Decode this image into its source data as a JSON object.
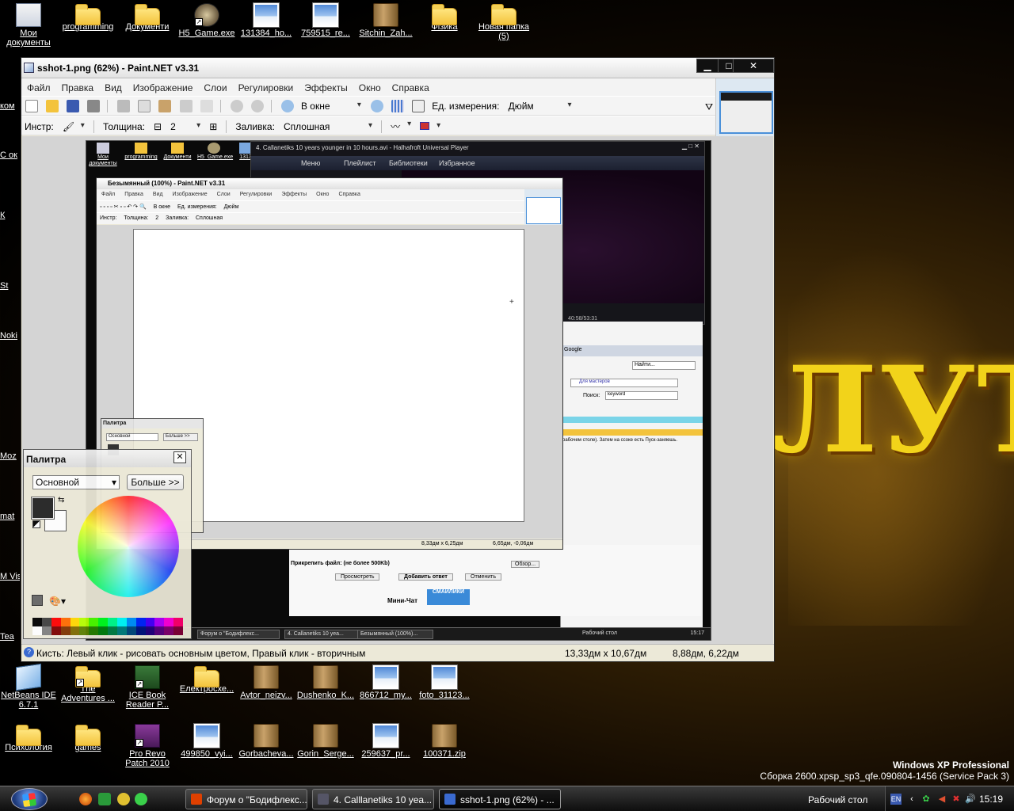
{
  "desktop": {
    "top_icons": [
      {
        "label": "Мои документы",
        "kind": "doc"
      },
      {
        "label": "programming",
        "kind": "folder"
      },
      {
        "label": "Документи",
        "kind": "folder"
      },
      {
        "label": "H5_Game.exe",
        "kind": "exe"
      },
      {
        "label": "131384_ho...",
        "kind": "image"
      },
      {
        "label": "759515_re...",
        "kind": "image"
      },
      {
        "label": "Sitchin_Zah...",
        "kind": "book"
      },
      {
        "label": "Фізика",
        "kind": "folder"
      },
      {
        "label": "Новая папка (5)",
        "kind": "folder"
      }
    ],
    "bottom_row1": [
      {
        "label": "NetBeans IDE 6.7.1",
        "kind": "cube"
      },
      {
        "label": "The Adventures ...",
        "kind": "folder"
      },
      {
        "label": "ICE Book Reader P...",
        "kind": "green"
      },
      {
        "label": "Електросхе...",
        "kind": "folder"
      },
      {
        "label": "Avtor_neizv...",
        "kind": "book"
      },
      {
        "label": "Dushenko_K...",
        "kind": "book"
      },
      {
        "label": "866712_my...",
        "kind": "image"
      },
      {
        "label": "foto_31123...",
        "kind": "image"
      }
    ],
    "bottom_row2": [
      {
        "label": "Психология",
        "kind": "folder"
      },
      {
        "label": "games",
        "kind": "folder"
      },
      {
        "label": "Pro Revo Patch 2010",
        "kind": "revo"
      },
      {
        "label": "499850_vyi...",
        "kind": "image"
      },
      {
        "label": "Gorbacheva...",
        "kind": "book"
      },
      {
        "label": "Gorin_Serge...",
        "kind": "book"
      },
      {
        "label": "259637_pr...",
        "kind": "image"
      },
      {
        "label": "100371.zip",
        "kind": "book"
      }
    ],
    "left_strip": [
      "ком",
      "С ок",
      "К",
      "St",
      "Noki",
      "Moz",
      "mat",
      "M Vis",
      "Tea"
    ],
    "wallpaper_text": "ЛУТ",
    "os_label": "Windows XP Professional",
    "build_label": "Сборка 2600.xpsp_sp3_qfe.090804-1456 (Service Pack 3)"
  },
  "window": {
    "title": "sshot-1.png (62%) - Paint.NET v3.31",
    "buttons": {
      "minimize": "▁",
      "maximize": "□",
      "close": "✕"
    },
    "menu": [
      "Файл",
      "Правка",
      "Вид",
      "Изображение",
      "Слои",
      "Регулировки",
      "Эффекты",
      "Окно",
      "Справка"
    ],
    "toolbar1": {
      "zoom_value": "В окне",
      "units_label": "Ед. измерения:",
      "units_value": "Дюйм"
    },
    "toolbar2": {
      "tool_label": "Инстр:",
      "thickness_label": "Толщина:",
      "thickness_value": "2",
      "fill_label": "Заливка:",
      "fill_value": "Сплошная"
    },
    "status": {
      "hint": "Кисть: Левый клик - рисовать основным цветом, Правый клик - вторичным",
      "size": "13,33дм x 10,67дм",
      "position": "8,88дм, 6,22дм"
    }
  },
  "shot": {
    "player_title": "4. Callanetiks 10 years younger in 10 hours.avi - Halhafroft Universal Player",
    "player_menu": [
      "Меню",
      "Плейлист",
      "Библиотеки",
      "Избранное"
    ],
    "player_time": "40:58/53:31",
    "inner_title": "Безымянный (100%) - Paint.NET v3.31",
    "inner_menu": [
      "Файл",
      "Правка",
      "Вид",
      "Изображение",
      "Слои",
      "Регулировки",
      "Эффекты",
      "Окно",
      "Справка"
    ],
    "inner_status_size": "8,33дм x 6,25дм",
    "inner_status_pos": "6,65дм, -0,06дм",
    "small_palette_title": "Палитра",
    "small_palette_select": "Основной",
    "small_palette_more": "Больше >>",
    "browser_search": "Google",
    "browser_find": "Найти...",
    "browser_for_whom": "Для мастеров",
    "browser_search_label": "Поиск:",
    "browser_keyword": "keyword",
    "forum_text": "рабочем столе). Затем на ссоке есть Пуск-заняешь.",
    "forum_attach": "Прикрепить файл: (не более 500Kb)",
    "forum_browse": "Обзор...",
    "forum_preview": "Просмотреть",
    "forum_add": "Добавить ответ",
    "forum_cancel": "Отменить",
    "forum_chat": "Мини-Чат",
    "forum_smileys": "СМАЙЛИКИ",
    "taskbar_items": [
      "Форум о \"Бодифлекс...",
      "4. Callanetiks 10 yea...",
      "Безымянный (100%)..."
    ],
    "tray_desktop": "Рабочий стол",
    "clock": "15:17"
  },
  "palette": {
    "title": "Палитра",
    "mode": "Основной",
    "more_button": "Больше >>",
    "primary_color": "#222222",
    "secondary_color": "#ffffff",
    "swatches": [
      "#000000",
      "#404040",
      "#ff0000",
      "#ff6a00",
      "#ffd800",
      "#b6ff00",
      "#4cff00",
      "#00ff21",
      "#00ff90",
      "#00ffff",
      "#0094ff",
      "#0026ff",
      "#4800ff",
      "#b200ff",
      "#ff00dc",
      "#ff006e",
      "#ffffff",
      "#808080",
      "#7f0000",
      "#7f3300",
      "#7f6a00",
      "#5b7f00",
      "#267f00",
      "#007f0e",
      "#007f46",
      "#007f7f",
      "#004a7f",
      "#00137f",
      "#21007f",
      "#57007f",
      "#7f006e",
      "#7f0037"
    ]
  },
  "taskbar": {
    "tasks": [
      {
        "label": "Форум о \"Бодифлекс...",
        "icon_color": "#e04000"
      },
      {
        "label": "4. Calllanetiks 10 yea...",
        "icon_color": "#555566"
      },
      {
        "label": "sshot-1.png (62%) - ...",
        "icon_color": "#3a6ad0"
      }
    ],
    "desktop_label": "Рабочий стол",
    "lang": "EN",
    "clock": "15:19"
  }
}
